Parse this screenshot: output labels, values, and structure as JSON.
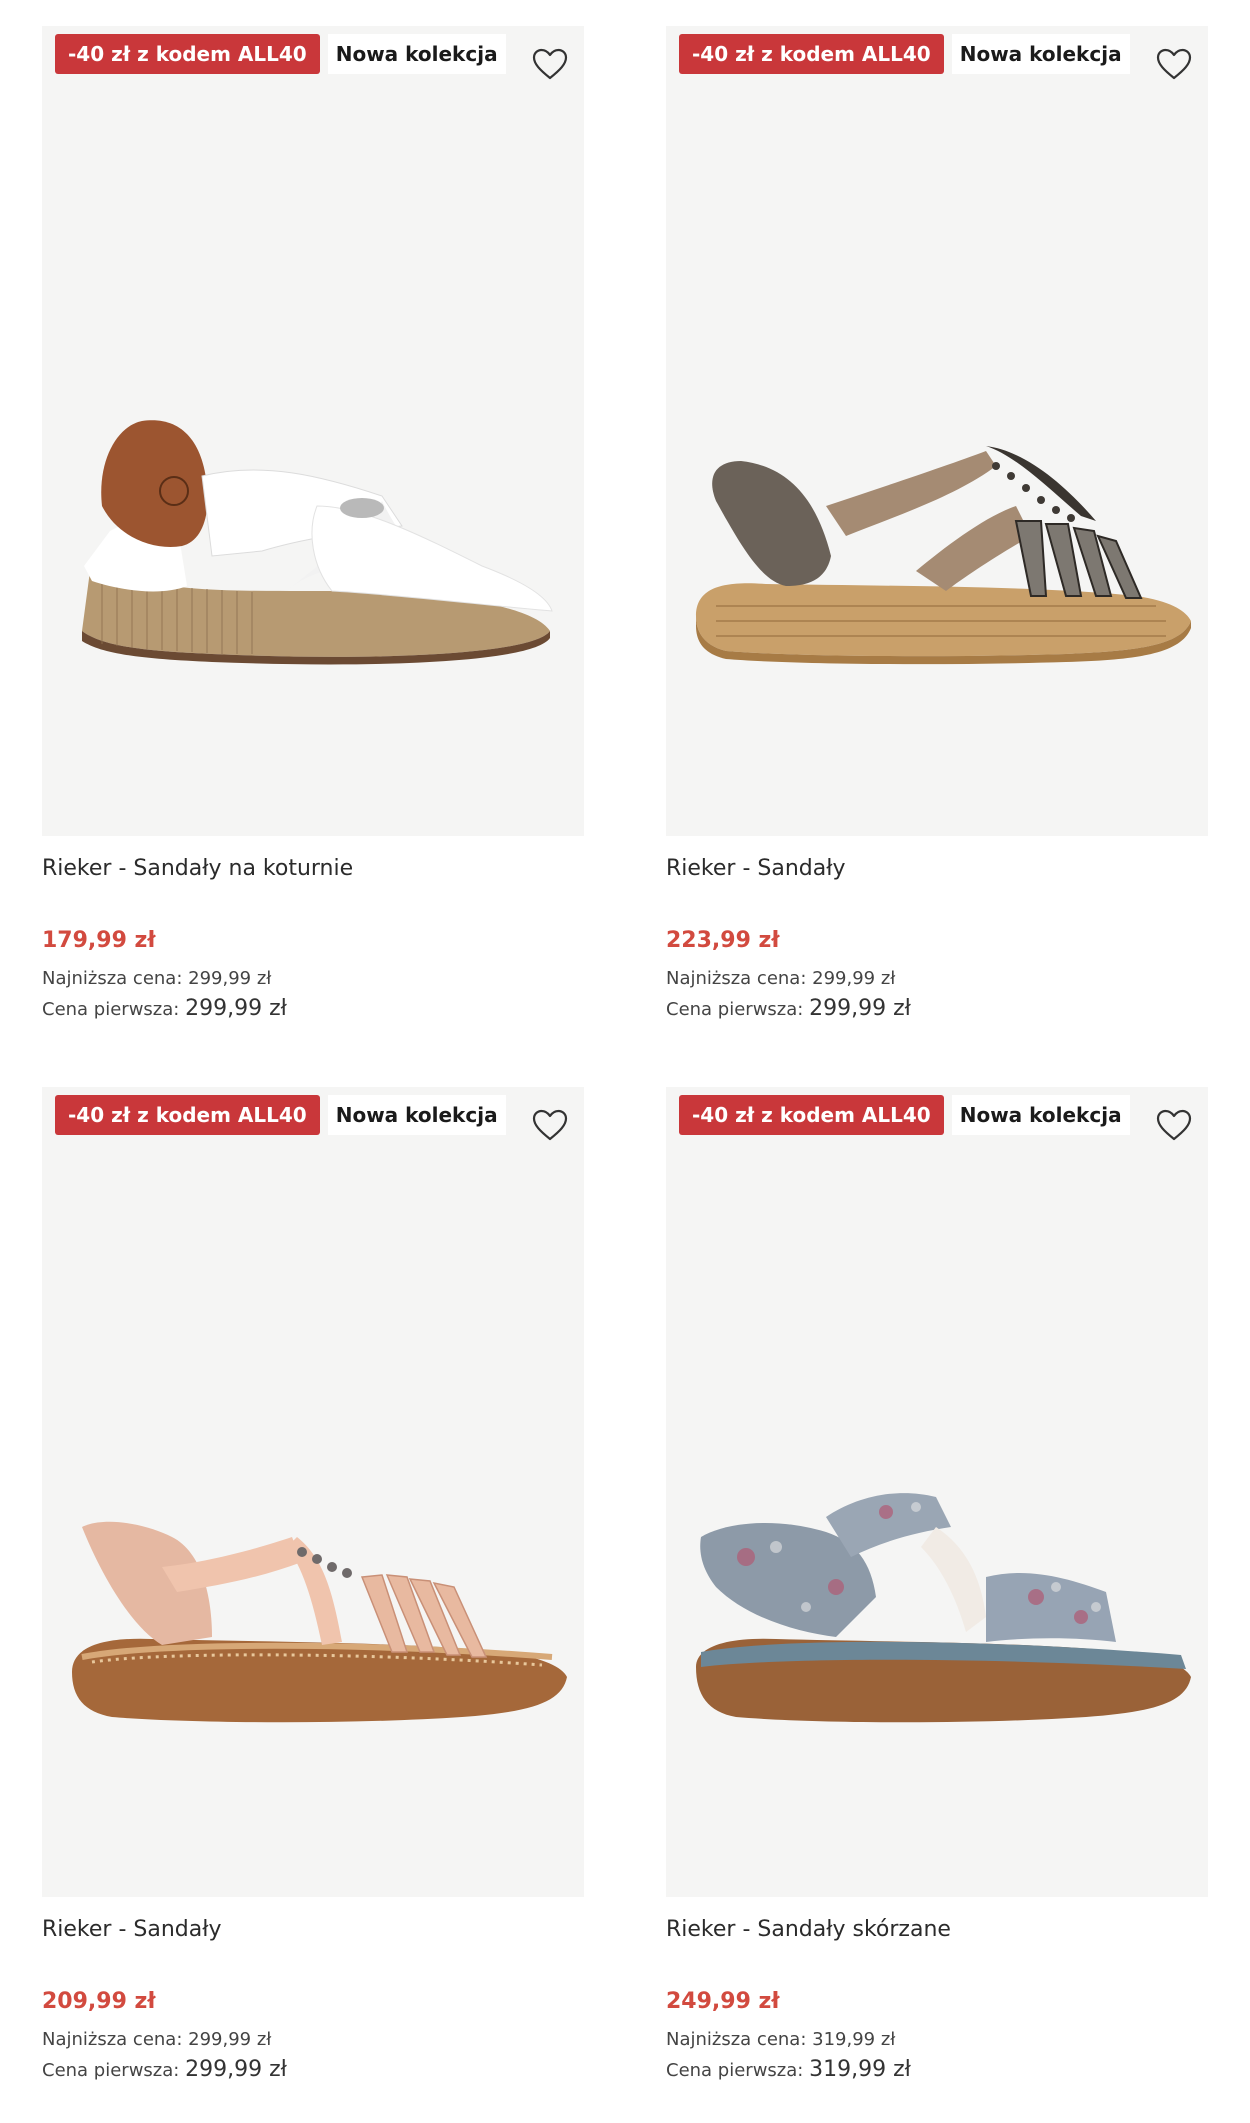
{
  "products": [
    {
      "badge_code": "-40 zł z kodem ALL40",
      "badge_new": "Nowa kolekcja",
      "name": "Rieker - Sandały na koturnie",
      "price": "179,99 zł",
      "lowest_label": "Najniższa cena:",
      "lowest_value": "299,99 zł",
      "first_label": "Cena pierwsza:",
      "first_value": "299,99 zł",
      "image": "white-brown-wedge-sandal"
    },
    {
      "badge_code": "-40 zł z kodem ALL40",
      "badge_new": "Nowa kolekcja",
      "name": "Rieker - Sandały",
      "price": "223,99 zł",
      "lowest_label": "Najniższa cena:",
      "lowest_value": "299,99 zł",
      "first_label": "Cena pierwsza:",
      "first_value": "299,99 zł",
      "image": "metallic-gray-sandal"
    },
    {
      "badge_code": "-40 zł z kodem ALL40",
      "badge_new": "Nowa kolekcja",
      "name": "Rieker - Sandały",
      "price": "209,99 zł",
      "lowest_label": "Najniższa cena:",
      "lowest_value": "299,99 zł",
      "first_label": "Cena pierwsza:",
      "first_value": "299,99 zł",
      "image": "pink-sandal"
    },
    {
      "badge_code": "-40 zł z kodem ALL40",
      "badge_new": "Nowa kolekcja",
      "name": "Rieker - Sandały skórzane",
      "price": "249,99 zł",
      "lowest_label": "Najniższa cena:",
      "lowest_value": "319,99 zł",
      "first_label": "Cena pierwsza:",
      "first_value": "319,99 zł",
      "image": "floral-blue-sandal"
    }
  ],
  "colors": {
    "badge_code_bg": "#c9373a",
    "price": "#d24a3f",
    "image_bg": "#f5f5f4"
  },
  "icons": {
    "wishlist": "heart-outline-icon"
  }
}
